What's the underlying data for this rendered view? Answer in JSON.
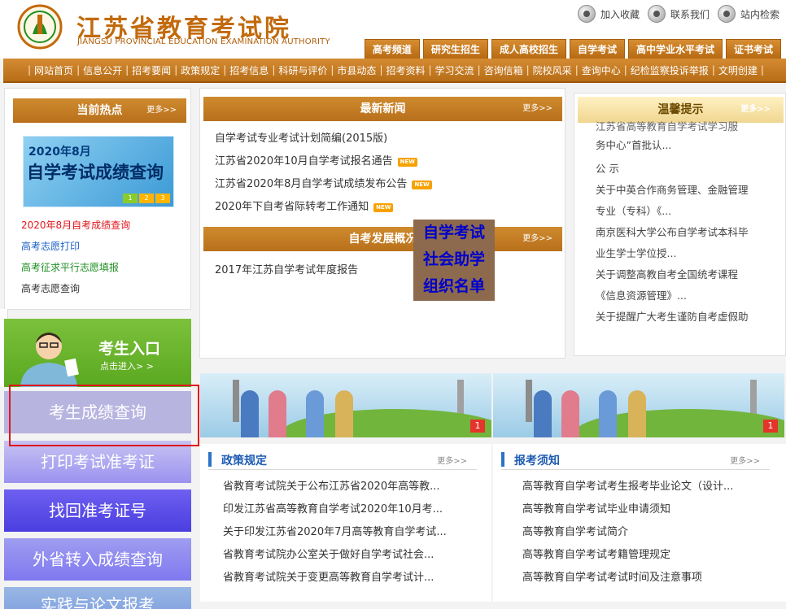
{
  "header": {
    "brand_cn": "江苏省教育考试院",
    "brand_en": "JIANGSU PROVINCIAL EDUCATION EXAMINATION AUTHORITY",
    "quick_links": [
      {
        "label": "加入收藏",
        "icon": "bookmark-icon"
      },
      {
        "label": "联系我们",
        "icon": "contact-icon"
      },
      {
        "label": "站内检索",
        "icon": "search-icon"
      }
    ],
    "tabs": [
      "高考频道",
      "研究生招生",
      "成人高校招生",
      "自学考试",
      "高中学业水平考试",
      "证书考试"
    ]
  },
  "nav": [
    "网站首页",
    "信息公开",
    "招考要闻",
    "政策规定",
    "招考信息",
    "科研与评价",
    "市县动态",
    "招考资料",
    "学习交流",
    "咨询信箱",
    "院校风采",
    "查询中心",
    "纪检监察投诉举报",
    "文明创建"
  ],
  "hot": {
    "title": "当前热点",
    "more": "更多>>",
    "banner_line1": "2020年8月",
    "banner_line2": "自学考试成绩查询",
    "banner_dots": [
      "1",
      "2",
      "3"
    ],
    "items": [
      {
        "text": "2020年8月自考成绩查询",
        "color": "#e0161b"
      },
      {
        "text": "高考志愿打印",
        "color": "#1b61c4"
      },
      {
        "text": "高考征求平行志愿填报",
        "color": "#1f8f22"
      },
      {
        "text": "高考志愿查询",
        "color": "#333333"
      }
    ]
  },
  "news": {
    "title": "最新新闻",
    "more": "更多>>",
    "items": [
      {
        "text": "自学考试专业考试计划简编(2015版)",
        "new": false
      },
      {
        "text": "江苏省2020年10月自学考试报名通告",
        "new": true
      },
      {
        "text": "江苏省2020年8月自学考试成绩发布公告",
        "new": true
      },
      {
        "text": "2020年下自考省际转考工作通知",
        "new": true
      }
    ],
    "new_badge": "NEW"
  },
  "development": {
    "title": "自考发展概况",
    "more": "更多>>",
    "items": [
      "2017年江苏自学考试年度报告"
    ]
  },
  "overlay_card": {
    "lines": [
      "自学考试",
      "社会助学",
      "组织名单"
    ]
  },
  "tips": {
    "title": "温馨提示",
    "more": "更多>>",
    "items": [
      {
        "l1": "江苏省高等教育自学考试学习服",
        "l2": "务中心”首批认..."
      },
      {
        "l1": "公 示",
        "l2": ""
      },
      {
        "l1": "关于中英合作商务管理、金融管理",
        "l2": "专业（专科）《..."
      },
      {
        "l1": "南京医科大学公布自学考试本科毕",
        "l2": "业生学士学位授..."
      },
      {
        "l1": "关于调整高教自考全国统考课程",
        "l2": "《信息资源管理》..."
      },
      {
        "l1": "关于提醒广大考生谨防自考虚假助",
        "l2": ""
      }
    ]
  },
  "entry": {
    "title": "考生入口",
    "sub": "点击进入> >"
  },
  "side_buttons": {
    "score": "考生成绩查询",
    "print": "打印考试准考证",
    "retrieve": "找回准考证号",
    "transfer": "外省转入成绩查询",
    "practice": "实践与论文报考"
  },
  "banners": [
    {
      "number": "1"
    },
    {
      "number": "1"
    }
  ],
  "policy": {
    "title": "政策规定",
    "more": "更多>>",
    "items": [
      "省教育考试院关于公布江苏省2020年高等教...",
      "印发江苏省高等教育自学考试2020年10月考...",
      "关于印发江苏省2020年7月高等教育自学考试...",
      "省教育考试院办公室关于做好自学考试社会...",
      "省教育考试院关于变更高等教育自学考试计..."
    ]
  },
  "notice": {
    "title": "报考须知",
    "more": "更多>>",
    "items": [
      "高等教育自学考试考生报考毕业论文（设计...",
      "高等教育自学考试毕业申请须知",
      "高等教育自学考试简介",
      "高等教育自学考试考籍管理规定",
      "高等教育自学考试考试时间及注意事项"
    ]
  },
  "colors": {
    "primary_orange": "#c26a0c",
    "nav_orange": "#b86d17",
    "accent_red": "#e0161b",
    "link_blue": "#1d5bb1"
  }
}
